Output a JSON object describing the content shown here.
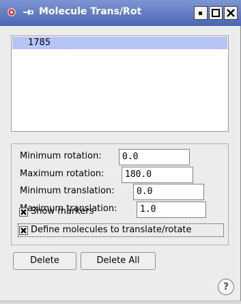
{
  "window": {
    "title": "Molecule Trans/Rot",
    "icons": [
      "app-icon",
      "pin-icon",
      "minimize-icon",
      "maximize-icon",
      "close-icon"
    ],
    "accent": "#5570bf"
  },
  "list": {
    "items": [
      "1785"
    ],
    "selected_index": 0,
    "selected_color": "#b6c5f5"
  },
  "params": {
    "min_rotation": {
      "label": "Minimum rotation:",
      "value": "0.0"
    },
    "max_rotation": {
      "label": "Maximum rotation:",
      "value": "180.0"
    },
    "min_translation": {
      "label": "Minimum translation:",
      "value": "0.0"
    },
    "max_translation": {
      "label": "Maximum translation:",
      "value": "1.0"
    },
    "show_markers": {
      "label": "Show markers",
      "checked": true
    },
    "define_molecules": {
      "label": "Define molecules to translate/rotate",
      "checked": true
    }
  },
  "buttons": {
    "delete": "Delete",
    "delete_all": "Delete All",
    "help": "?"
  }
}
